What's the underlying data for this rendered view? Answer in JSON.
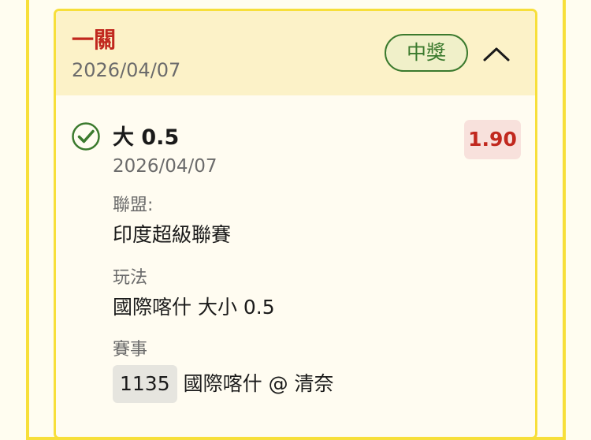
{
  "bet": {
    "type_label": "一關",
    "date": "2026/04/07",
    "status_label": "中獎",
    "collapse_icon": "chevron-up-icon"
  },
  "selection": {
    "status_icon": "check-circle-icon",
    "name": "大 0.5",
    "date": "2026/04/07",
    "odds": "1.90",
    "league_label": "聯盟:",
    "league_value": "印度超級聯賽",
    "market_label": "玩法",
    "market_value": "國際喀什 大小 0.5",
    "event_label": "賽事",
    "event_id": "1135",
    "event_name": "國際喀什 @ 清奈"
  },
  "colors": {
    "accent_red": "#c1281e",
    "success_green": "#3b7a2e",
    "border_yellow": "#f7df3a",
    "header_bg": "#fcf2c8"
  }
}
